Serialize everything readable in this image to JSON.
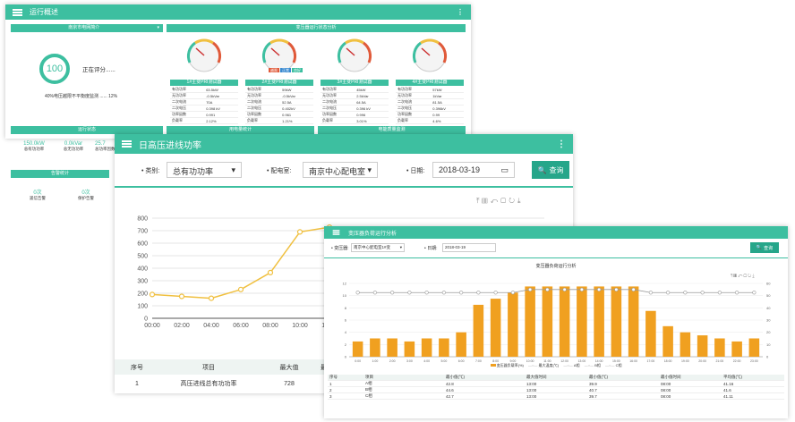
{
  "bg": {
    "title": "运行概述",
    "left_header": "南京市电网简介",
    "score_value": "100",
    "score_label": "正在评分......",
    "score_desc": "40%电压越限不平衡度监测 ...... 12%",
    "gauge_header": "变压器运行状态分析",
    "gauges": [
      {
        "label": "1#主变PRI测试器",
        "rows": [
          [
            "有功功率",
            "63.5kW"
          ],
          [
            "无功功率",
            "-0.5kVar"
          ],
          [
            "二次电流",
            "70A"
          ],
          [
            "二次电压",
            "0.398 kV"
          ],
          [
            "功率因数",
            "0.991"
          ],
          [
            "负载率",
            "2.12%"
          ]
        ]
      },
      {
        "label": "2#主变PRI测试器",
        "rows": [
          [
            "有功功率",
            "59kW"
          ],
          [
            "无功功率",
            "-0.5kVar"
          ],
          [
            "二次电流",
            "52.5A"
          ],
          [
            "二次电压",
            "0.402kV"
          ],
          [
            "功率因数",
            "0.961"
          ],
          [
            "负载率",
            "1.21%"
          ]
        ]
      },
      {
        "label": "3#主变PRI测试器",
        "rows": [
          [
            "有功功率",
            "45kW"
          ],
          [
            "无功功率",
            "2.5kVar"
          ],
          [
            "二次电流",
            "64.5A"
          ],
          [
            "二次电压",
            "0.396 kV"
          ],
          [
            "功率因数",
            "0.996"
          ],
          [
            "负载率",
            "3.01%"
          ]
        ]
      },
      {
        "label": "4#主变PRI测试器",
        "rows": [
          [
            "有功功率",
            "57kW"
          ],
          [
            "无功功率",
            "1kVar"
          ],
          [
            "二次电流",
            "81.5A"
          ],
          [
            "二次电压",
            "0.396kV"
          ],
          [
            "功率因数",
            "0.99"
          ],
          [
            "负载率",
            "4.6%"
          ]
        ]
      }
    ],
    "legend_badges": [
      "越限",
      "正常",
      "良好"
    ],
    "status_header": "运行状态",
    "status_values": [
      {
        "v": "150.0kW",
        "l": "总有功功率"
      },
      {
        "v": "0.0kVar",
        "l": "总无功功率"
      },
      {
        "v": "25.7",
        "l": "总功率因数"
      }
    ],
    "alarm_header": "告警统计",
    "alarm_values": [
      {
        "v": "0次",
        "l": "遥信告警"
      },
      {
        "v": "0次",
        "l": "保护告警"
      }
    ],
    "tab2": "用电量统计",
    "tab3": "电能质量监测"
  },
  "mid": {
    "title": "日高压进线功率",
    "type_label": "类别:",
    "type_value": "总有功功率",
    "site_label": "配电室:",
    "site_value": "南京中心配电室",
    "date_label": "日期:",
    "date_value": "2018-03-19",
    "query": "查询",
    "table_headers": [
      "序号",
      "项目",
      "最大值",
      "最"
    ],
    "table_row": [
      "1",
      "高压进线总有功功率",
      "728",
      ""
    ]
  },
  "front": {
    "title": "变压器负荷运行分析",
    "f_type_label": "变压器:",
    "f_type_value": "南京中心配电室1#变",
    "f_date_label": "日期:",
    "f_date_value": "2018-03-19",
    "query": "查询",
    "chart_title": "变压器负荷运行分析",
    "legend": [
      "变压器负载率(%)",
      "最大温度(℃)",
      "A相",
      "B相",
      "C相"
    ],
    "table_headers": [
      "序号",
      "项目",
      "最小值(℃)",
      "最大值时间",
      "最小值(℃)",
      "最小值时间",
      "平均值(℃)"
    ],
    "rows": [
      [
        "1",
        "A相",
        "42.8",
        "13:00",
        "39.9",
        "08:00",
        "41.16"
      ],
      [
        "2",
        "B相",
        "44.6",
        "13:00",
        "40.7",
        "08:00",
        "41.6"
      ],
      [
        "3",
        "C相",
        "42.7",
        "13:00",
        "39.7",
        "08:00",
        "41.11"
      ]
    ]
  },
  "chart_data": [
    {
      "type": "line",
      "x": [
        "00:00",
        "02:00",
        "04:00",
        "06:00",
        "08:00",
        "10:00",
        "12:00"
      ],
      "values": [
        190,
        175,
        160,
        230,
        365,
        690,
        728
      ],
      "yticks": [
        0,
        100,
        200,
        300,
        400,
        500,
        600,
        700,
        800
      ],
      "ylim": [
        0,
        800
      ]
    },
    {
      "type": "bar",
      "x": [
        "0:00",
        "1:00",
        "2:00",
        "3:00",
        "4:00",
        "5:00",
        "6:00",
        "7:00",
        "8:00",
        "9:00",
        "10:00",
        "11:00",
        "12:00",
        "13:00",
        "14:00",
        "15:00",
        "16:00",
        "17:00",
        "18:00",
        "19:00",
        "20:00",
        "21:00",
        "22:00",
        "23:00"
      ],
      "bar_values": [
        2.5,
        3,
        3,
        2.5,
        3,
        3,
        4,
        8.5,
        9.5,
        10.5,
        11.5,
        11.5,
        11.5,
        11.5,
        11.5,
        11.5,
        11.5,
        7.5,
        5,
        4,
        3.5,
        3,
        2.5,
        3
      ],
      "line_values": [
        10.5,
        10.5,
        10.5,
        10.5,
        10.5,
        10.5,
        10.5,
        10.5,
        10.5,
        10.5,
        11,
        11,
        11,
        11,
        11,
        11,
        11,
        10.5,
        10.5,
        10.5,
        10.5,
        10.5,
        10.5,
        10.5
      ],
      "yticks": [
        0,
        2,
        4,
        6,
        8,
        10,
        12
      ],
      "ylim": [
        0,
        12
      ],
      "y2ticks": [
        0,
        10,
        20,
        30,
        40,
        50,
        60
      ],
      "bar_color": "#f0a020",
      "line_color": "#999999"
    }
  ]
}
